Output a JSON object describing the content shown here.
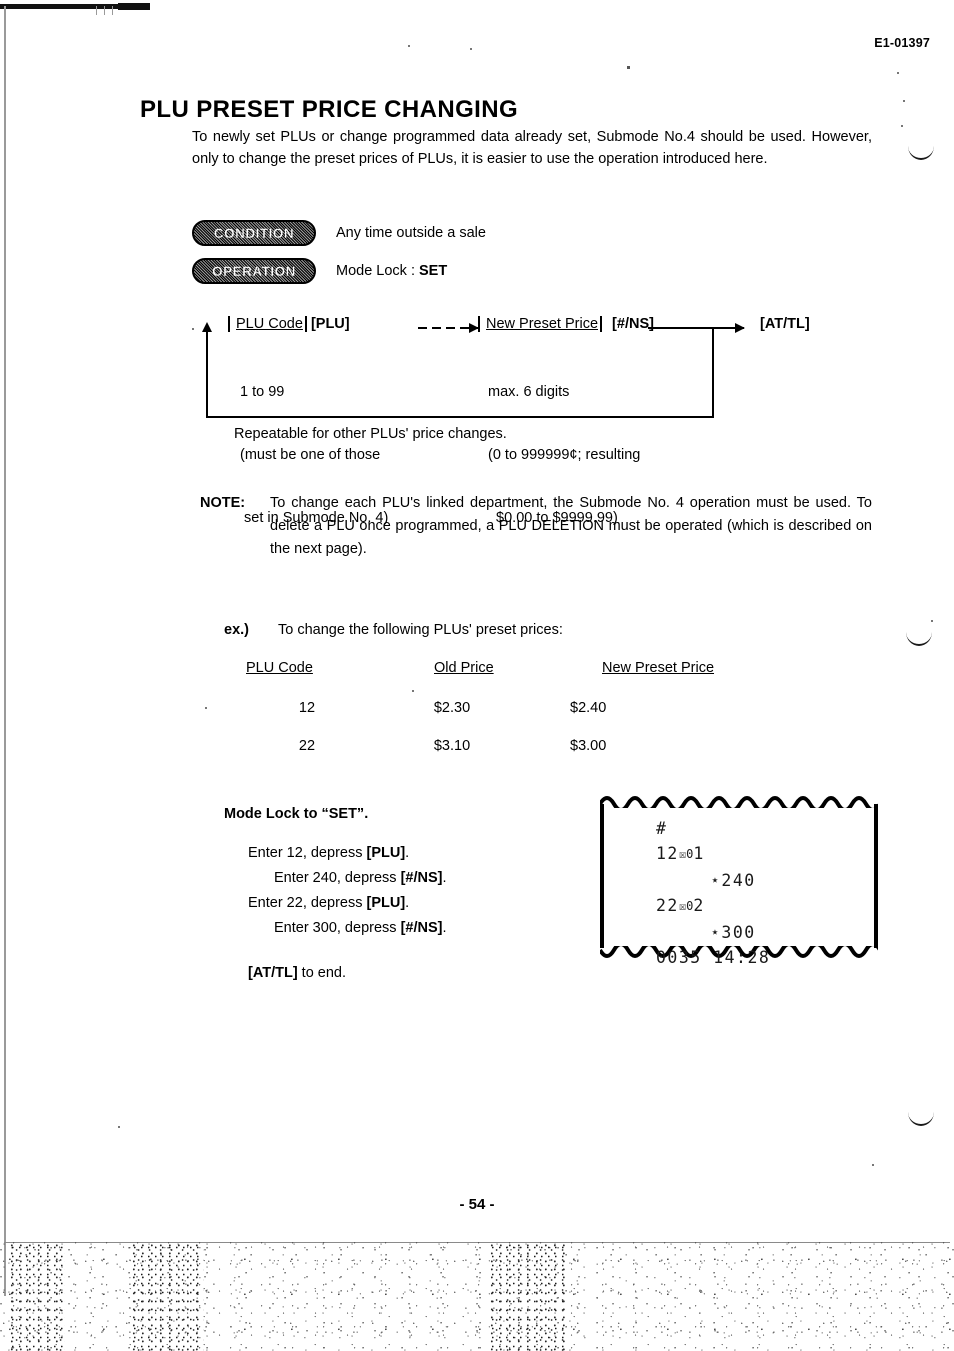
{
  "header": {
    "doc_code": "E1-01397"
  },
  "page": {
    "title": "PLU PRESET PRICE CHANGING",
    "page_number": "- 54 -"
  },
  "intro": {
    "line1": "To newly set PLUs or change programmed data already set, Submode No.4 should be used.",
    "line2": "However, only to change the preset prices of PLUs, it is easier to use the operation introduced here."
  },
  "badges": {
    "condition": {
      "pill": "CONDITION",
      "text": "Any time outside a sale"
    },
    "operation": {
      "pill": "OPERATION",
      "text_prefix": "Mode Lock : ",
      "text_value": "SET"
    }
  },
  "flow": {
    "node1": {
      "field": "PLU Code",
      "key": "[PLU]",
      "detail_line1": "1 to 99",
      "detail_line2": "(must be one of those",
      "detail_line3": " set in Submode No. 4)"
    },
    "node2": {
      "field": "New Preset Price",
      "key": "[#/NS]",
      "detail_line1": "max. 6 digits",
      "detail_line2": "(0 to 999999¢; resulting",
      "detail_line3": "  $0.00 to $9999.99)"
    },
    "node3": {
      "key": "[AT/TL]"
    },
    "repeatable": "Repeatable for other PLUs' price changes."
  },
  "note": {
    "label": "NOTE:",
    "body": "To change each PLU's linked department, the Submode No. 4 operation must be used.   To delete a PLU once programmed, a PLU DELETION must be operated (which is described on the next page)."
  },
  "example": {
    "label": "ex.)",
    "intro": "To change the following PLUs' preset prices:",
    "columns": [
      "PLU Code",
      "Old Price",
      "New Preset Price"
    ],
    "rows": [
      {
        "plu_code": "12",
        "old_price": "$2.30",
        "new_price": "$2.40"
      },
      {
        "plu_code": "22",
        "old_price": "$3.10",
        "new_price": "$3.00"
      }
    ]
  },
  "steps": {
    "head_prefix": "Mode Lock to ",
    "head_value": "“SET”",
    "head_suffix": ".",
    "line1_a": "Enter 12, depress ",
    "line1_b": "[PLU]",
    "line1_c": ".",
    "line2_a": "Enter 240, depress ",
    "line2_b": "[#/NS]",
    "line2_c": ".",
    "line3_a": "Enter 22, depress ",
    "line3_b": "[PLU]",
    "line3_c": ".",
    "line4_a": "Enter 300, depress ",
    "line4_b": "[#/NS]",
    "line4_c": ".",
    "end_a": "[AT/TL]",
    "end_b": " to end."
  },
  "receipt": {
    "lines": [
      {
        "text": "#",
        "indent": false
      },
      {
        "text": "12",
        "dept": "☒0",
        "tail": "1",
        "indent": false
      },
      {
        "text": "⋆240",
        "indent": true
      },
      {
        "text": "22",
        "dept": "☒0",
        "tail": "2",
        "indent": false
      },
      {
        "text": "⋆300",
        "indent": true
      },
      {
        "text": "0035 14:28",
        "indent": false
      }
    ]
  }
}
